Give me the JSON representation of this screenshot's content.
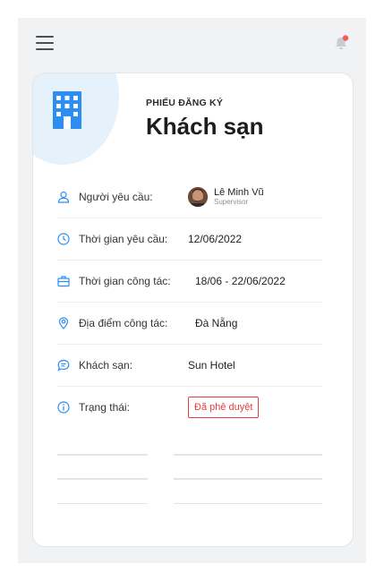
{
  "header": {
    "menu_icon": "hamburger-icon",
    "notification_icon": "bell-icon",
    "notification_dot_color": "#f25c54"
  },
  "card": {
    "icon": "building-icon",
    "subtitle": "PHIẾU ĐĂNG KÝ",
    "title": "Khách sạn",
    "fields": {
      "requester": {
        "label": "Người yêu cầu:",
        "name": "Lê Minh Vũ",
        "role": "Supervisor"
      },
      "request_time": {
        "label": "Thời gian yêu cầu:",
        "value": "12/06/2022"
      },
      "trip_time": {
        "label": "Thời gian công tác:",
        "value": "18/06 - 22/06/2022"
      },
      "location": {
        "label": "Địa điểm công tác:",
        "value": "Đà Nẵng"
      },
      "hotel": {
        "label": "Khách sạn:",
        "value": "Sun Hotel"
      },
      "status": {
        "label": "Trạng thái:",
        "value": "Đã phê duyệt",
        "color": "#e53e3e"
      }
    }
  },
  "colors": {
    "accent": "#2b8ef0",
    "blob": "#e5f2fc"
  }
}
